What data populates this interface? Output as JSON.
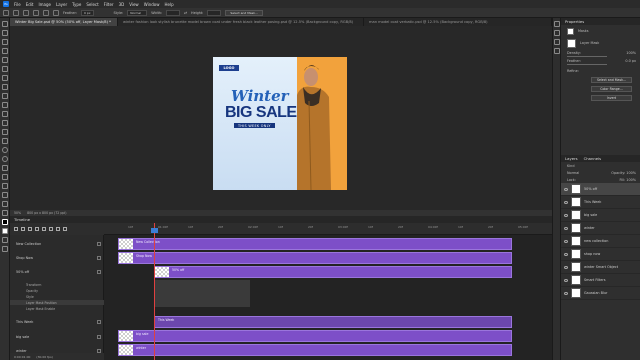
{
  "menu": [
    "File",
    "Edit",
    "Image",
    "Layer",
    "Type",
    "Select",
    "Filter",
    "3D",
    "View",
    "Window",
    "Help"
  ],
  "options": {
    "feather_label": "Feather:",
    "feather_value": "0 px",
    "style_label": "Style:",
    "style_value": "Normal",
    "width_label": "Width:",
    "height_label": "Height:",
    "select_mask_button": "Select and Mask..."
  },
  "tabs": [
    {
      "label": "Winter Big Sale.psd @ 50% (50% off, Layer Mask/8) *",
      "active": true
    },
    {
      "label": "winter fashion look stylish brunette model brown coat under fresh black leather posing.psd @ 12.5% (Background copy, RGB/8)",
      "active": false
    },
    {
      "label": "man model coat verbatic.psd @ 12.5% (Background copy, RGB/8)",
      "active": false
    }
  ],
  "artboard": {
    "logo": "LOGO",
    "headline_1": "Winter",
    "headline_2": "BIG SALE",
    "tagline": "THIS WEEK ONLY"
  },
  "status": {
    "zoom": "50%",
    "doc": "800 px x 800 px (72 ppi)"
  },
  "properties": {
    "title": "Properties",
    "masks_label": "Masks",
    "layer_mask_label": "Layer Mask",
    "density_label": "Density:",
    "density_value": "100%",
    "feather_label": "Feather:",
    "feather_value": "0.0 px",
    "refine_label": "Refine:",
    "select_mask_button": "Select and Mask...",
    "color_range_button": "Color Range...",
    "invert_button": "Invert"
  },
  "layers_panel": {
    "tabs": [
      "Layers",
      "Channels"
    ],
    "kind": "Kind",
    "blend": "Normal",
    "opacity_label": "Opacity:",
    "opacity_value": "100%",
    "lock_label": "Lock:",
    "fill_label": "Fill:",
    "fill_value": "100%",
    "layers": [
      {
        "name": "50% off",
        "selected": true
      },
      {
        "name": "This Week",
        "selected": false
      },
      {
        "name": "big sale",
        "selected": false
      },
      {
        "name": "winter",
        "selected": false
      },
      {
        "name": "new collection",
        "selected": false
      },
      {
        "name": "shop now",
        "selected": false
      },
      {
        "name": "winter Smart Object",
        "selected": false
      },
      {
        "name": "Smart Filters",
        "selected": false
      },
      {
        "name": "Gaussian Blur",
        "selected": false
      }
    ]
  },
  "timeline": {
    "title": "Timeline",
    "rows": [
      "New Collection",
      "Shop Now",
      "50% off",
      "Transform",
      "Opacity",
      "Style",
      "Layer Mask Position",
      "Layer Mask Enable",
      "This Week",
      "big sale",
      "winter"
    ],
    "ticks": [
      "10f",
      "01:00f",
      "10f",
      "20f",
      "02:00f",
      "10f",
      "20f",
      "03:00f",
      "10f",
      "20f",
      "04:00f",
      "10f",
      "20f",
      "05:00f"
    ],
    "clips": [
      "New Collection",
      "Shop Now",
      "50% off",
      "This Week",
      "big sale",
      "winter"
    ],
    "timecode": "0:00:01:00",
    "fps": "(30.00 fps)"
  }
}
